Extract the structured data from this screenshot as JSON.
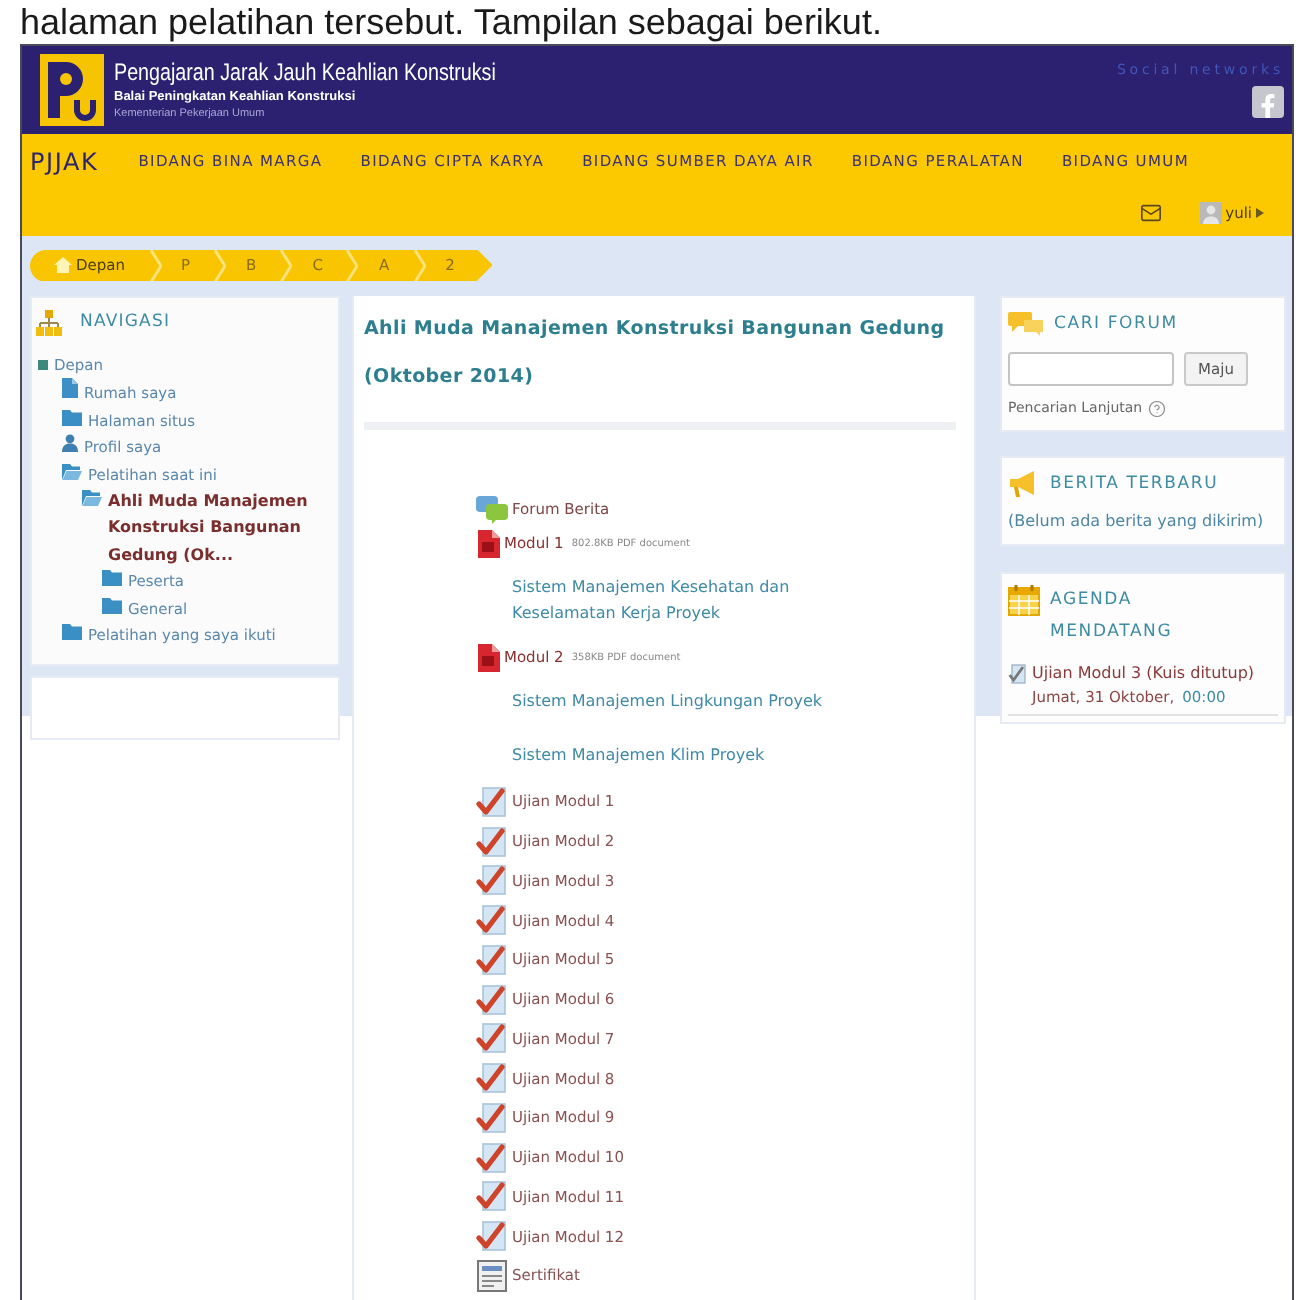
{
  "caption": "halaman pelatihan tersebut. Tampilan sebagai berikut.",
  "header": {
    "title": "Pengajaran Jarak Jauh Keahlian Konstruksi",
    "subtitle": "Balai Peningkatan Keahlian Konstruksi",
    "ministry": "Kementerian Pekerjaan Umum",
    "social_label": "Social networks"
  },
  "nav": {
    "brand": "PJJAK",
    "items": [
      "BIDANG BINA MARGA",
      "BIDANG CIPTA KARYA",
      "BIDANG SUMBER DAYA AIR",
      "BIDANG PERALATAN",
      "BIDANG UMUM"
    ],
    "user": "yuli"
  },
  "breadcrumb": [
    {
      "label": "Depan",
      "kind": "home"
    },
    {
      "label": "P",
      "kind": "text"
    },
    {
      "label": "B",
      "kind": "text"
    },
    {
      "label": "C",
      "kind": "text"
    },
    {
      "label": "A",
      "kind": "text"
    },
    {
      "label": "2",
      "kind": "text"
    }
  ],
  "navigation": {
    "title": "NAVIGASI",
    "tree": [
      {
        "label": "Depan",
        "kind": "bullet",
        "selected": false,
        "children": [
          {
            "label": "Rumah saya",
            "kind": "page",
            "selected": false
          },
          {
            "label": "Halaman situs",
            "kind": "folder",
            "selected": false
          },
          {
            "label": "Profil saya",
            "kind": "user",
            "selected": false
          },
          {
            "label": "Pelatihan saat ini",
            "kind": "folder-open",
            "selected": false,
            "children": [
              {
                "label": "Ahli Muda Manajemen Konstruksi Bangunan Gedung (Ok...",
                "kind": "folder-open",
                "selected": true,
                "children": [
                  {
                    "label": "Peserta",
                    "kind": "folder",
                    "selected": false
                  },
                  {
                    "label": "General",
                    "kind": "folder",
                    "selected": false
                  }
                ]
              }
            ]
          },
          {
            "label": "Pelatihan yang saya ikuti",
            "kind": "folder",
            "selected": false
          }
        ]
      }
    ]
  },
  "course": {
    "title": "Ahli Muda Manajemen Konstruksi Bangunan Gedung (Oktober 2014)",
    "items": [
      {
        "kind": "forum",
        "label": "Forum Berita"
      },
      {
        "kind": "file",
        "label": "Modul 1",
        "info": "802.8KB PDF document"
      },
      {
        "kind": "label",
        "label": "Sistem Manajemen Kesehatan dan Keselamatan Kerja Proyek"
      },
      {
        "kind": "file",
        "label": "Modul 2",
        "info": "358KB PDF document"
      },
      {
        "kind": "label",
        "label": "Sistem Manajemen Lingkungan Proyek"
      },
      {
        "kind": "label",
        "label": "Sistem Manajemen Klim Proyek"
      },
      {
        "kind": "quiz",
        "label": "Ujian Modul 1"
      },
      {
        "kind": "quiz",
        "label": "Ujian Modul 2"
      },
      {
        "kind": "quiz",
        "label": "Ujian Modul 3"
      },
      {
        "kind": "quiz",
        "label": "Ujian Modul 4"
      },
      {
        "kind": "quiz",
        "label": "Ujian Modul 5"
      },
      {
        "kind": "quiz",
        "label": "Ujian Modul 6"
      },
      {
        "kind": "quiz",
        "label": "Ujian Modul 7"
      },
      {
        "kind": "quiz",
        "label": "Ujian Modul 8"
      },
      {
        "kind": "quiz",
        "label": "Ujian Modul 9"
      },
      {
        "kind": "quiz",
        "label": "Ujian Modul 10"
      },
      {
        "kind": "quiz",
        "label": "Ujian Modul 11"
      },
      {
        "kind": "quiz",
        "label": "Ujian Modul 12"
      },
      {
        "kind": "certificate",
        "label": "Sertifikat"
      }
    ]
  },
  "search_forum": {
    "title": "CARI FORUM",
    "button": "Maju",
    "advanced_link": "Pencarian Lanjutan"
  },
  "latest_news": {
    "title": "BERITA TERBARU",
    "message": "(Belum ada berita yang dikirim)"
  },
  "upcoming_events": {
    "title": "AGENDA MENDATANG",
    "events": [
      {
        "name": "Ujian Modul 3 (Kuis ditutup)",
        "date": "Jumat, 31 Oktober,",
        "time": "00:00"
      }
    ]
  }
}
